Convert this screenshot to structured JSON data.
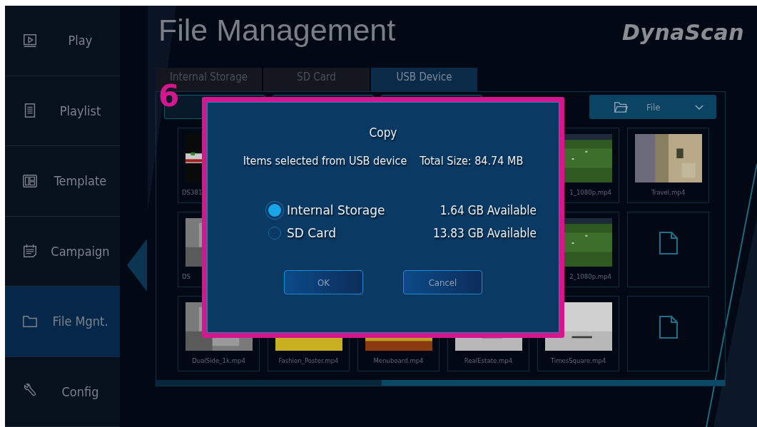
{
  "sidebar": {
    "items": [
      {
        "label": "Play",
        "selected": false
      },
      {
        "label": "Playlist",
        "selected": false
      },
      {
        "label": "Template",
        "selected": false
      },
      {
        "label": "Campaign",
        "selected": false
      },
      {
        "label": "File Mgnt.",
        "selected": true
      },
      {
        "label": "Config",
        "selected": false
      }
    ]
  },
  "page_title": "File Management",
  "logo": "DynaScan",
  "tabs": [
    {
      "label": "Internal Storage",
      "selected": false
    },
    {
      "label": "SD Card",
      "selected": false
    },
    {
      "label": "USB Device",
      "selected": true
    }
  ],
  "file_filter": {
    "value": "File"
  },
  "grid": {
    "rows": [
      [
        {
          "kind": "picture",
          "caption": "DS381"
        },
        null,
        null,
        null,
        {
          "kind": "picture",
          "caption": "1_1080p.mp4"
        },
        {
          "kind": "picture",
          "caption": "Travel.mp4"
        }
      ],
      [
        {
          "kind": "picture",
          "caption": "DS"
        },
        null,
        null,
        null,
        {
          "kind": "picture",
          "caption": "2_1080p.mp4"
        },
        {
          "kind": "file"
        }
      ],
      [
        {
          "kind": "picture",
          "caption": "DualSide_1k.mp4"
        },
        {
          "kind": "picture",
          "caption": "Fashion_Poster.mp4"
        },
        {
          "kind": "picture",
          "caption": "Menuboard.mp4"
        },
        {
          "kind": "picture",
          "caption": "RealEstate.mp4"
        },
        {
          "kind": "picture",
          "caption": "TimesSquare.mp4"
        },
        {
          "kind": "file"
        }
      ]
    ]
  },
  "annotation": "6",
  "dialog": {
    "title": "Copy",
    "source": "Items selected from USB device",
    "total_size": "Total Size: 84.74 MB",
    "options": [
      {
        "label": "Internal Storage",
        "available": "1.64 GB Available",
        "selected": true
      },
      {
        "label": "SD Card",
        "available": "13.83 GB Available",
        "selected": false
      }
    ],
    "buttons": [
      "OK",
      "Cancel"
    ]
  }
}
